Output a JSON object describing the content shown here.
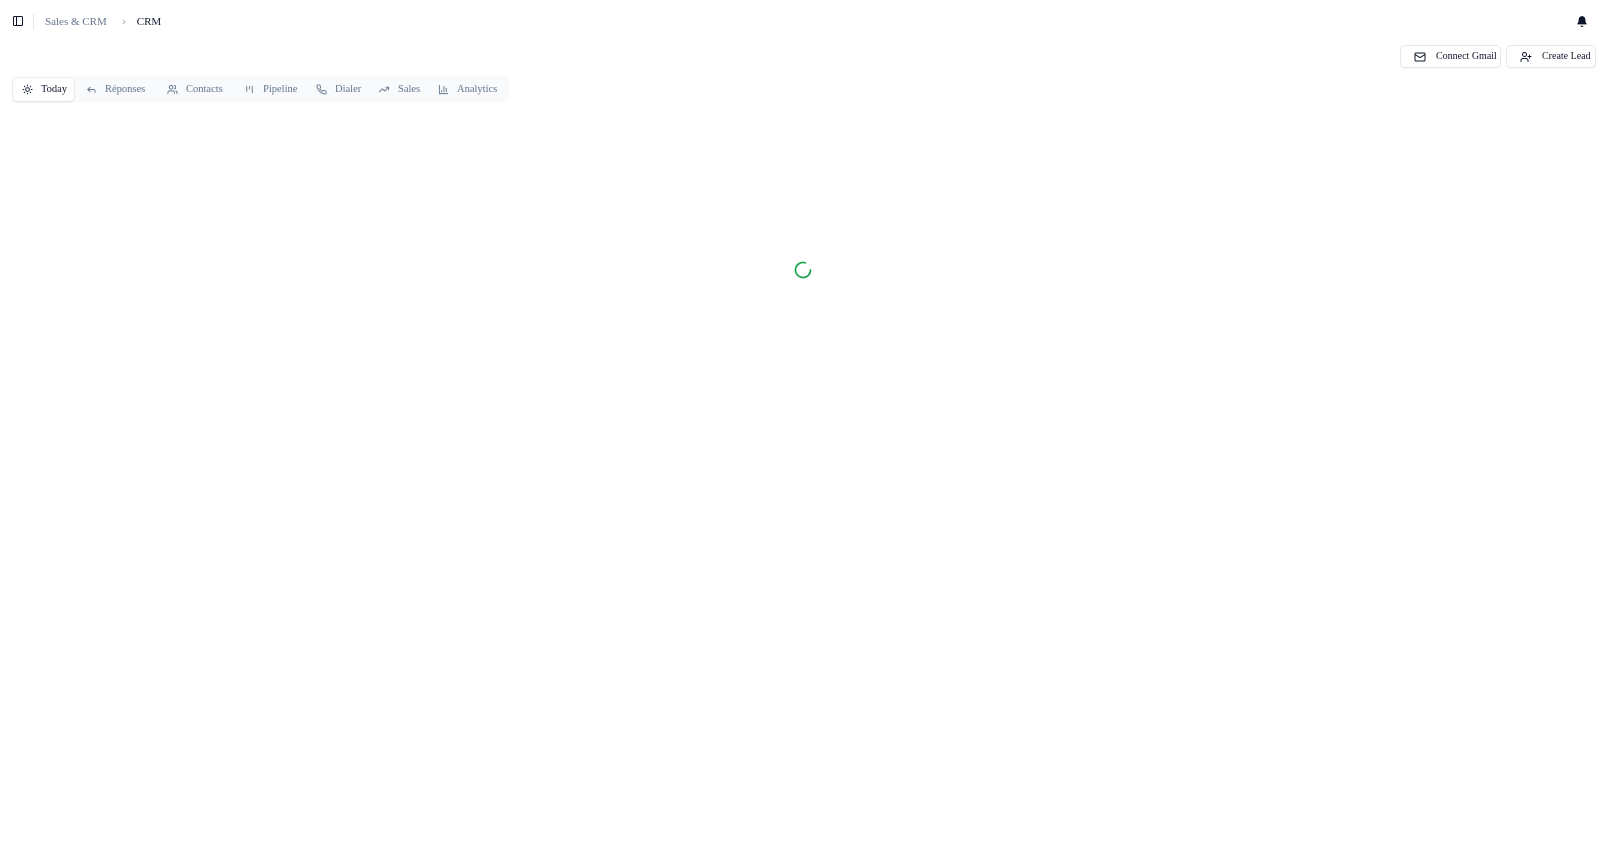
{
  "header": {
    "sidebar_toggle_icon": "panel-left-icon",
    "breadcrumb": {
      "parent": "Sales & CRM",
      "current": "CRM"
    },
    "notification_icon": "bell-icon"
  },
  "actions": {
    "connect_gmail": {
      "label": "Connect Gmail",
      "icon": "mail-icon"
    },
    "create_lead": {
      "label": "Create Lead",
      "icon": "user-plus-icon"
    }
  },
  "tabs": [
    {
      "label": "Today",
      "icon": "sun-icon",
      "active": true
    },
    {
      "label": "Réponses",
      "icon": "reply-icon",
      "active": false
    },
    {
      "label": "Contacts",
      "icon": "users-icon",
      "active": false
    },
    {
      "label": "Pipeline",
      "icon": "kanban-icon",
      "active": false
    },
    {
      "label": "Dialer",
      "icon": "phone-icon",
      "active": false
    },
    {
      "label": "Sales",
      "icon": "trending-up-icon",
      "active": false
    },
    {
      "label": "Analytics",
      "icon": "bar-chart-icon",
      "active": false
    }
  ],
  "main": {
    "loading": true,
    "spinner_icon": "loader-icon",
    "spinner_color": "#16a34a"
  },
  "colors": {
    "text_primary": "#0f172a",
    "text_muted": "#64748b",
    "border": "#e2e8f0",
    "tabs_background": "#f8fafc",
    "accent": "#16a34a"
  }
}
